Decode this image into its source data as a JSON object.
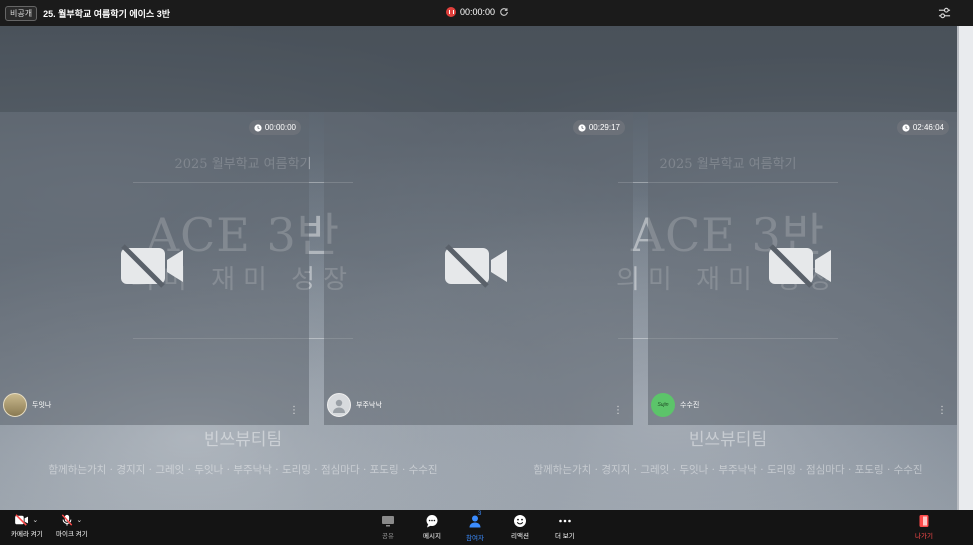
{
  "header": {
    "visibility_badge": "비공개",
    "title": "25. 월부학교 여름학기 에이스 3반",
    "recording_time": "00:00:00",
    "colors": {
      "record": "#e0403c",
      "bar": "#1b1b1b"
    },
    "icons": [
      "record-icon",
      "refresh-icon",
      "settings-sliders-icon"
    ]
  },
  "poster": {
    "subtitle": "2025 월부학교 여름학기",
    "headline": "ACE 3반",
    "slogan": "의미 재미 성장",
    "team": "빈쓰뷰티팀",
    "members": "함께하는가치 · 경지지 · 그레잇 · 두잇나 · 부주낙낙 · 도리밍 · 점심마다 · 포도링 · 수수진"
  },
  "tiles": [
    {
      "timer": "00:00:00",
      "name": "두잇나",
      "camera": "off"
    },
    {
      "timer": "00:29:17",
      "name": "부주낙낙",
      "camera": "off"
    },
    {
      "timer": "02:46:04",
      "name": "수수진",
      "camera": "off",
      "avatar_text": "Sujin"
    }
  ],
  "toolbar": {
    "camera_label": "카메라 켜기",
    "mic_label": "마이크 켜기",
    "share_label": "공유",
    "message_label": "메시지",
    "participants_label": "참여자",
    "participants_count": "3",
    "reaction_label": "리액션",
    "more_label": "더 보기",
    "leave_label": "나가기",
    "colors": {
      "active": "#3b8cff",
      "leave": "#ff4b4b"
    }
  }
}
